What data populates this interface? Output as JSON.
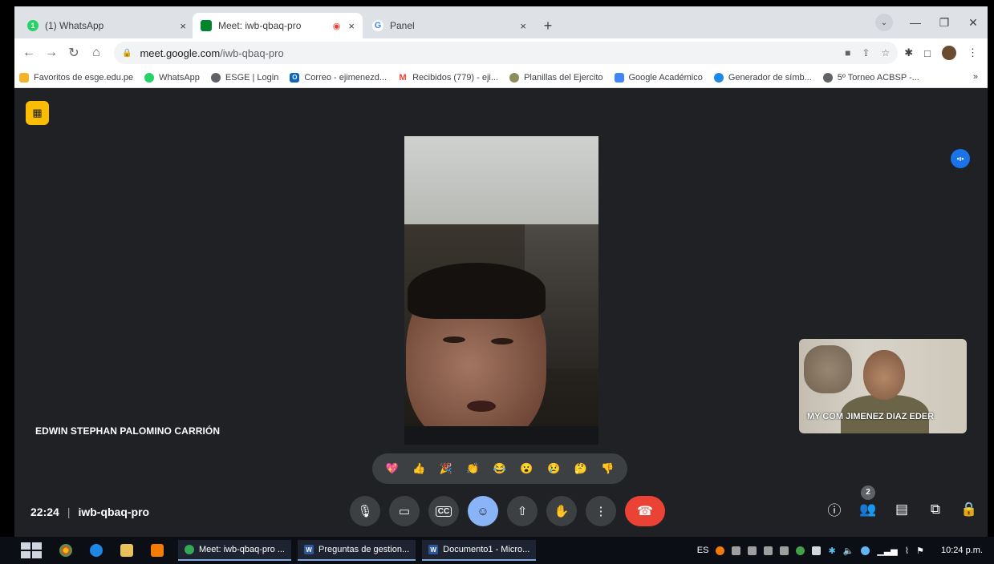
{
  "browser": {
    "tabs": [
      {
        "label": "(1) WhatsApp",
        "close": "×"
      },
      {
        "label": "Meet: iwb-qbaq-pro",
        "close": "×"
      },
      {
        "label": "Panel",
        "close": "×"
      }
    ],
    "new_tab": "+",
    "url_host": "meet.google.com",
    "url_path": "/iwb-qbaq-pro",
    "bookmarks": [
      {
        "label": "Favoritos de esge.edu.pe",
        "color": "#f2b32b"
      },
      {
        "label": "WhatsApp",
        "color": "#25d366"
      },
      {
        "label": "ESGE | Login",
        "color": "#5f6368"
      },
      {
        "label": "Correo - ejimenezd...",
        "color": "#0a64c6"
      },
      {
        "label": "Recibidos (779) - eji...",
        "color": "#ea4335"
      },
      {
        "label": "Planillas del Ejercito",
        "color": "#8d8d5a"
      },
      {
        "label": "Google Académico",
        "color": "#4285f4"
      },
      {
        "label": "Generador de símb...",
        "color": "#1e88e5"
      },
      {
        "label": "5º Torneo ACBSP -...",
        "color": "#5f6368"
      }
    ],
    "bookmarks_more": "»"
  },
  "meet": {
    "main_participant": "EDWIN STEPHAN PALOMINO CARRIÓN",
    "self_participant": "MY COM JIMENEZ DIAZ EDER",
    "reactions": [
      "💖",
      "👍",
      "🎉",
      "👏",
      "😂",
      "😮",
      "😢",
      "🤔",
      "👎"
    ],
    "time": "22:24",
    "separator": "|",
    "meeting_code": "iwb-qbaq-pro",
    "participants_count": "2",
    "end_call_color": "#ea4335",
    "accent_color": "#8ab4f8"
  },
  "taskbar": {
    "tasks": [
      "Meet: iwb-qbaq-pro ...",
      "Preguntas de gestion...",
      "Documento1 - Micro..."
    ],
    "language": "ES",
    "time": "10:24 p.m."
  }
}
